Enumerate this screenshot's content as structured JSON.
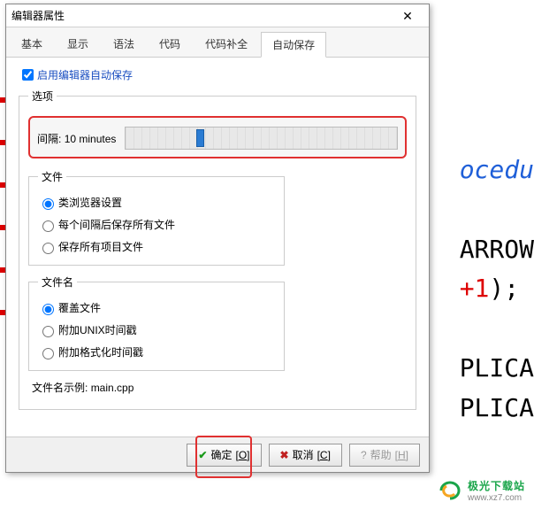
{
  "dialog": {
    "title": "编辑器属性"
  },
  "tabs": {
    "items": [
      {
        "label": "基本"
      },
      {
        "label": "显示"
      },
      {
        "label": "语法"
      },
      {
        "label": "代码"
      },
      {
        "label": "代码补全"
      },
      {
        "label": "自动保存"
      }
    ],
    "active_index": 5
  },
  "autosave": {
    "enable_label": "启用编辑器自动保存",
    "enable_checked": true,
    "options_legend": "选项",
    "interval_prefix": "间隔:",
    "interval_value": "10 minutes",
    "file_legend": "文件",
    "file_options": [
      {
        "label": "类浏览器设置",
        "checked": true
      },
      {
        "label": "每个间隔后保存所有文件",
        "checked": false
      },
      {
        "label": "保存所有项目文件",
        "checked": false
      }
    ],
    "filename_legend": "文件名",
    "filename_options": [
      {
        "label": "覆盖文件",
        "checked": true
      },
      {
        "label": "附加UNIX时间戳",
        "checked": false
      },
      {
        "label": "附加格式化时间戳",
        "checked": false
      }
    ],
    "example_prefix": "文件名示例:",
    "example_value": "main.cpp"
  },
  "buttons": {
    "ok": "确定",
    "ok_key": "O",
    "cancel": "取消",
    "cancel_key": "C",
    "help": "帮助",
    "help_key": "H"
  },
  "background_code": {
    "line1": "ocedu",
    "line2": "ARROW",
    "line3a": "+1",
    "line3b": ");",
    "line4": "PLICA",
    "line5": "PLICA"
  },
  "watermark": {
    "cn": "极光下载站",
    "en": "www.xz7.com"
  }
}
